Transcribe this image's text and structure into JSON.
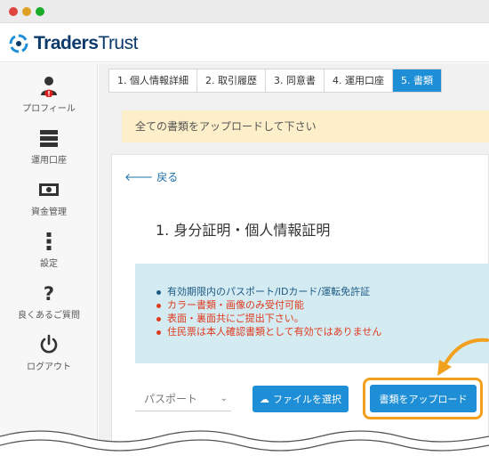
{
  "window": {
    "title": ""
  },
  "brand": {
    "name_bold": "Traders",
    "name_rest": "Trust",
    "color": "#0b3a6b"
  },
  "sidebar": {
    "items": [
      {
        "label": "プロフィール",
        "icon": "user-icon",
        "alert": "!"
      },
      {
        "label": "運用口座",
        "icon": "server-icon"
      },
      {
        "label": "資金管理",
        "icon": "money-icon"
      },
      {
        "label": "設定",
        "icon": "vertical-dots-icon"
      },
      {
        "label": "良くあるご質問",
        "icon": "question-icon"
      },
      {
        "label": "ログアウト",
        "icon": "power-icon"
      }
    ]
  },
  "steps": [
    {
      "label": "1.  個人情報詳細",
      "active": false
    },
    {
      "label": "2.  取引履歴",
      "active": false
    },
    {
      "label": "3.  同意書",
      "active": false
    },
    {
      "label": "4.  運用口座",
      "active": false
    },
    {
      "label": "5.  書類",
      "active": true
    }
  ],
  "notice": {
    "text": "全ての書類をアップロードして下さい"
  },
  "card": {
    "back_label": "戻る",
    "title": "1.   身分証明・個人情報証明",
    "requirements": [
      {
        "text": "有効期限内のパスポート/IDカード/運転免許証",
        "color": "#1e5a86"
      },
      {
        "text": "カラー書類・画像のみ受付可能",
        "color": "#e03a1e"
      },
      {
        "text": "表面・裏面共にご提出下さい。",
        "color": "#e03a1e"
      },
      {
        "text": "住民票は本人確認書類として有効ではありません",
        "color": "#e03a1e"
      }
    ],
    "doc_type_select": {
      "value": "パスポート"
    },
    "choose_file_label": "ファイルを選択",
    "upload_label": "書類をアップロード"
  },
  "colors": {
    "accent": "#1e8fd6",
    "highlight": "#f2a11f",
    "notice_bg": "#fcefc9",
    "info_bg": "#d3ebf1"
  }
}
